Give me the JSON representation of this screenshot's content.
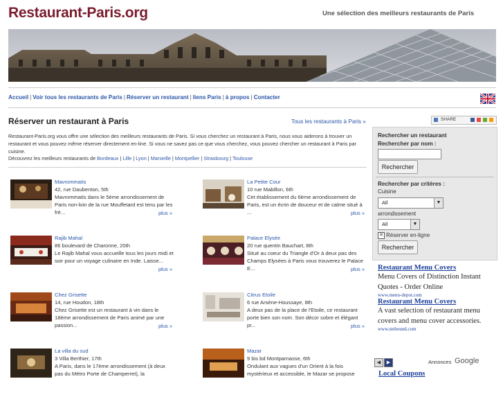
{
  "site": {
    "logo": "Restaurant-Paris.org",
    "tagline": "Une sélection des meilleurs restaurants de Paris"
  },
  "nav": {
    "items": [
      "Accueil",
      "Voir tous les restaurants de Paris",
      "Réserver un restaurant",
      "liens Paris",
      "à propos",
      "Contacter"
    ],
    "separator": "|"
  },
  "main": {
    "heading": "Réserver un restaurant à Paris",
    "all_link": "Tous les restaurants à Paris »",
    "intro": "Restaurant-Paris.org vous offre une sélection des meilleurs restaurants de Paris. Si vous cherchez un restaurant à Paris, nous vous aiderons à trouver un restaurant et vous pouvez même réserver directement en-line. Si vous ne savez pas ce que vous cherchez, vous pouvez chercher un restaurant à Paris par cuisine.",
    "cities_prefix": "Découvrez les meilleurs restaurants de",
    "cities": [
      "Bordeaux",
      "Lille",
      "Lyon",
      "Marseille",
      "Montpellier",
      "Strasbourg",
      "Toulouse"
    ]
  },
  "restaurants": [
    {
      "name": "Mavrommatis",
      "address": "42, rue Daubenton, 5th",
      "desc": "Mavrommatis dans le 5ème arrondissement de Paris non-loin de la rue Mouffetard est tenu par les frè...",
      "more": "plus »"
    },
    {
      "name": "La Petite Cour",
      "address": "10 rue Mabillon, 6th",
      "desc": "Cet établissement du 6ème arrondissement de Paris, est un écrin de douceur et de calme situé à ...",
      "more": "plus »"
    },
    {
      "name": "Rajib Mahal",
      "address": "86 boulevard de Charonne, 20th",
      "desc": "Le Rajib Mahal vous accueille tous les jours midi et soir pour un voyage culinaire en Inde. Laisse...",
      "more": "plus »"
    },
    {
      "name": "Palace Elysée",
      "address": "20 rue quentin Bauchart, 8th",
      "desc": "Situé au coeur du Triangle d'Or à deux pas des Champs Elysées à Paris vous trouverez le Palace E...",
      "more": "plus »"
    },
    {
      "name": "Chez Grisette",
      "address": "14, rue Houdon, 18th",
      "desc": "Chez Grisette est un restaurant à vin dans le 18ème arrondissement de Paris animé par une passion...",
      "more": "plus »"
    },
    {
      "name": "Citrus Etoile",
      "address": "6 rue Arsène-Houssaye, 8th",
      "desc": "A deux pas de la place de l'Etoile, ce restaurant porte bien son nom. Son décor sobre et élégant pr...",
      "more": "plus »"
    },
    {
      "name": "La villa du sud",
      "address": "3 Villa Berthier, 17th",
      "desc": "A Paris, dans le 17ème arrondissement (à deux pas du Métro Porte de Champerret), la",
      "more": ""
    },
    {
      "name": "Mazar",
      "address": "9 bis bd Montparnasse, 6th",
      "desc": "Ondulant aux vagues d'un Orient à la fois mystérieux et accessible, le Mazar se propose",
      "more": ""
    }
  ],
  "share": {
    "label": "SHARE"
  },
  "search_box": {
    "title": "Rechercher un restaurant",
    "by_name_label": "Rechercher par nom :",
    "name_value": "",
    "search_button": "Rechercher",
    "by_criteria_label": "Rechercher par critères :",
    "cuisine_label": "Cuisine",
    "cuisine_value": "All",
    "arrondissement_label": "arrondissement",
    "arrondissement_value": "All",
    "online_label": "Réserver en-ligne",
    "online_checked": true,
    "search_button2": "Rechercher"
  },
  "ads": [
    {
      "title": "Restaurant Menu Covers",
      "body": "Menu Covers of Distinction Instant Quotes - Order Online",
      "url": "www.menu-depot.com"
    },
    {
      "title": "Restaurant Menu Covers",
      "body": "A vast selection of restaurant menu covers and menu cover accessories.",
      "url": "www.stebound.com"
    }
  ],
  "ads_footer": {
    "label": "Annonces",
    "brand": "Google",
    "next_ad": "Local Coupons"
  },
  "colors": {
    "brand": "#7a1c2e",
    "link": "#2a56a8",
    "ad_link": "#1a3e9a",
    "sidebar_bg": "#e8e8e8"
  }
}
